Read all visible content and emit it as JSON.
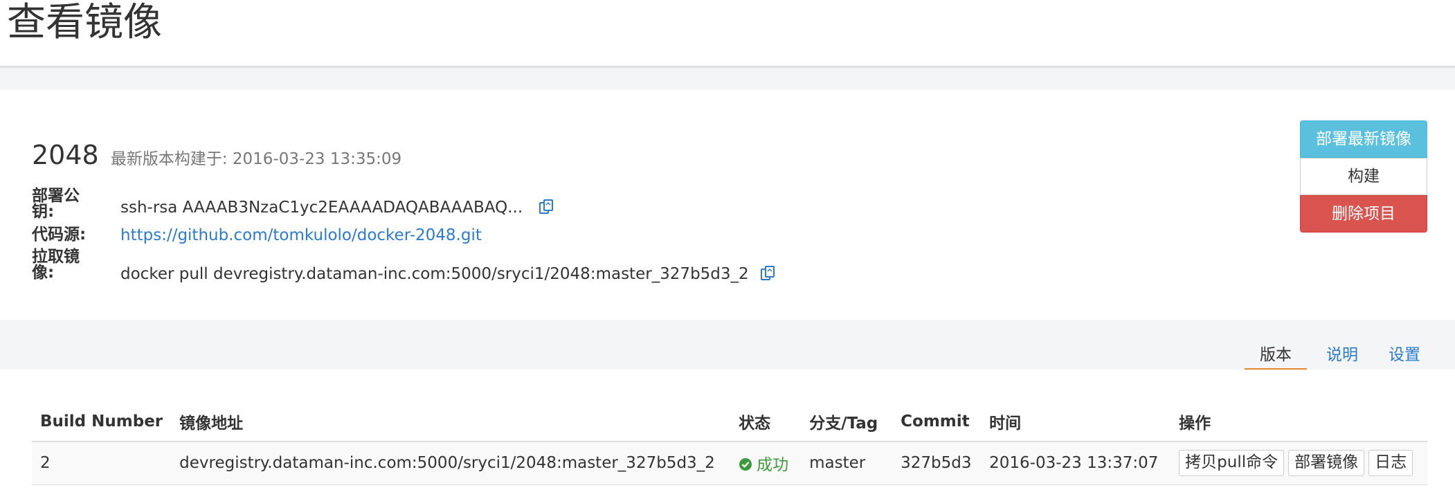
{
  "page": {
    "title": "查看镜像"
  },
  "project": {
    "name": "2048",
    "build_time_label": "最新版本构建于: 2016-03-23 13:35:09",
    "fields": {
      "deploy_key_label": "部署公钥:",
      "deploy_key_value": "ssh-rsa AAAAB3NzaC1yc2EAAAADAQABAAABAQ...",
      "source_label": "代码源:",
      "source_value": "https://github.com/tomkulolo/docker-2048.git",
      "pull_label": "拉取镜像:",
      "pull_value": "docker pull devregistry.dataman-inc.com:5000/sryci1/2048:master_327b5d3_2"
    },
    "actions": {
      "deploy_latest": "部署最新镜像",
      "build": "构建",
      "delete": "删除项目"
    }
  },
  "tabs": [
    {
      "label": "版本",
      "active": true
    },
    {
      "label": "说明",
      "active": false
    },
    {
      "label": "设置",
      "active": false
    }
  ],
  "builds_table": {
    "headers": [
      "Build Number",
      "镜像地址",
      "状态",
      "分支/Tag",
      "Commit",
      "时间",
      "操作"
    ],
    "rows": [
      {
        "build_number": "2",
        "image": "devregistry.dataman-inc.com:5000/sryci1/2048:master_327b5d3_2",
        "status": "成功",
        "branch": "master",
        "commit": "327b5d3",
        "time": "2016-03-23 13:37:07",
        "actions": [
          "拷贝pull命令",
          "部署镜像",
          "日志"
        ]
      }
    ]
  },
  "colors": {
    "accent": "#2a7bd0",
    "info": "#5bc0de",
    "danger": "#d9534f",
    "success": "#3c9a3c",
    "tab_underline": "#e08a2c"
  },
  "icons": {
    "copy": "copy-icon",
    "status": "check-circle-icon"
  }
}
